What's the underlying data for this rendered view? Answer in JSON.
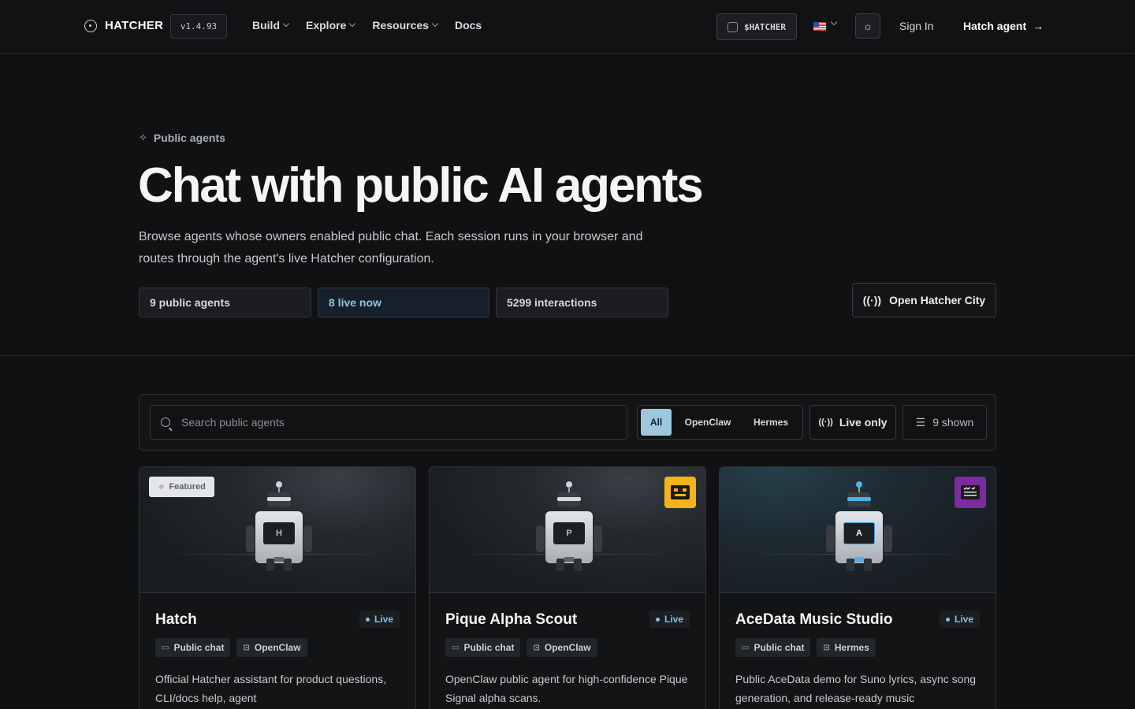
{
  "nav": {
    "brand": "HATCHER",
    "version": "v1.4.93",
    "links": [
      {
        "label": "Build",
        "has_dropdown": true
      },
      {
        "label": "Explore",
        "has_dropdown": true
      },
      {
        "label": "Resources",
        "has_dropdown": true
      },
      {
        "label": "Docs",
        "has_dropdown": false
      }
    ],
    "token": "$HATCHER",
    "sign_in": "Sign In",
    "cta": "Hatch agent",
    "cta_icon": "arrow-right-icon",
    "theme_icon": "sun-icon"
  },
  "hero": {
    "eyebrow": "Public agents",
    "title": "Chat with public AI agents",
    "subtitle": "Browse agents whose owners enabled public chat. Each session runs in your browser and routes through the agent's live Hatcher configuration.",
    "stats": [
      "9 public agents",
      "8 live now",
      "5299 interactions"
    ],
    "city_button": "Open Hatcher City"
  },
  "filters": {
    "search_placeholder": "Search public agents",
    "segments": [
      "All",
      "OpenClaw",
      "Hermes"
    ],
    "active_segment": "All",
    "live_only": "Live only",
    "shown": "9 shown"
  },
  "cards": [
    {
      "title": "Hatch",
      "initial": "H",
      "featured": "Featured",
      "status": "Live",
      "tags": [
        "Public chat",
        "OpenClaw"
      ],
      "description": "Official Hatcher assistant for product questions, CLI/docs help, agent"
    },
    {
      "title": "Pique Alpha Scout",
      "initial": "P",
      "status": "Live",
      "tags": [
        "Public chat",
        "OpenClaw"
      ],
      "description": "OpenClaw public agent for high-confidence Pique Signal alpha scans.",
      "badge_color": "#f4b319"
    },
    {
      "title": "AceData Music Studio",
      "initial": "A",
      "status": "Live",
      "tags": [
        "Public chat",
        "Hermes"
      ],
      "description": "Public AceData demo for Suno lyrics, async song generation, and release-ready music",
      "badge_color": "#7d2a9d"
    }
  ],
  "colors": {
    "background": "#101113",
    "accent": "#9dc7dc",
    "live": "#7ec2e4"
  }
}
